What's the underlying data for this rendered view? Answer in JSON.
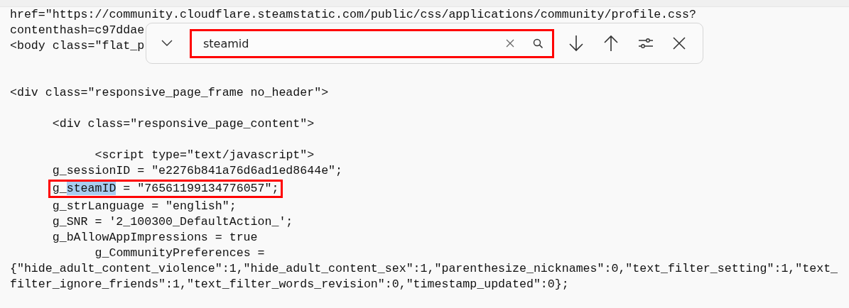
{
  "code_lines": [
    {
      "kind": "code",
      "text": "href=\"https://community.cloudflare.steamstatic.com/public/css/applications/community/profile.css?"
    },
    {
      "kind": "code",
      "text": "contenthash=c97ddae"
    },
    {
      "kind": "code",
      "text": "<body class=\"flat_p"
    },
    {
      "kind": "blank"
    },
    {
      "kind": "blank"
    },
    {
      "kind": "code",
      "text": "<div class=\"responsive_page_frame no_header\">"
    },
    {
      "kind": "blank"
    },
    {
      "kind": "code",
      "text": "      <div class=\"responsive_page_content\">"
    },
    {
      "kind": "blank"
    },
    {
      "kind": "code",
      "text": "            <script type=\"text/javascript\">"
    },
    {
      "kind": "code",
      "text": "      g_sessionID = \"e2276b841a76d6ad1ed8644e\";"
    },
    {
      "kind": "code",
      "boxed": true,
      "parts": [
        {
          "text": "      g_",
          "highlighted": false
        },
        {
          "text": "steamID",
          "highlighted": true
        },
        {
          "text": " = \"76561199134776057\";",
          "highlighted": false
        }
      ]
    },
    {
      "kind": "code",
      "text": "      g_strLanguage = \"english\";"
    },
    {
      "kind": "code",
      "text": "      g_SNR = '2_100300_DefaultAction_';"
    },
    {
      "kind": "code",
      "text": "      g_bAllowAppImpressions = true"
    },
    {
      "kind": "code",
      "text": "            g_CommunityPreferences ="
    },
    {
      "kind": "code",
      "text": "{\"hide_adult_content_violence\":1,\"hide_adult_content_sex\":1,\"parenthesize_nicknames\":0,\"text_filter_setting\":1,\"text_"
    },
    {
      "kind": "code",
      "text": "filter_ignore_friends\":1,\"text_filter_words_revision\":0,\"timestamp_updated\":0};"
    }
  ],
  "find_bar": {
    "query": "steamid",
    "boxed": true
  }
}
